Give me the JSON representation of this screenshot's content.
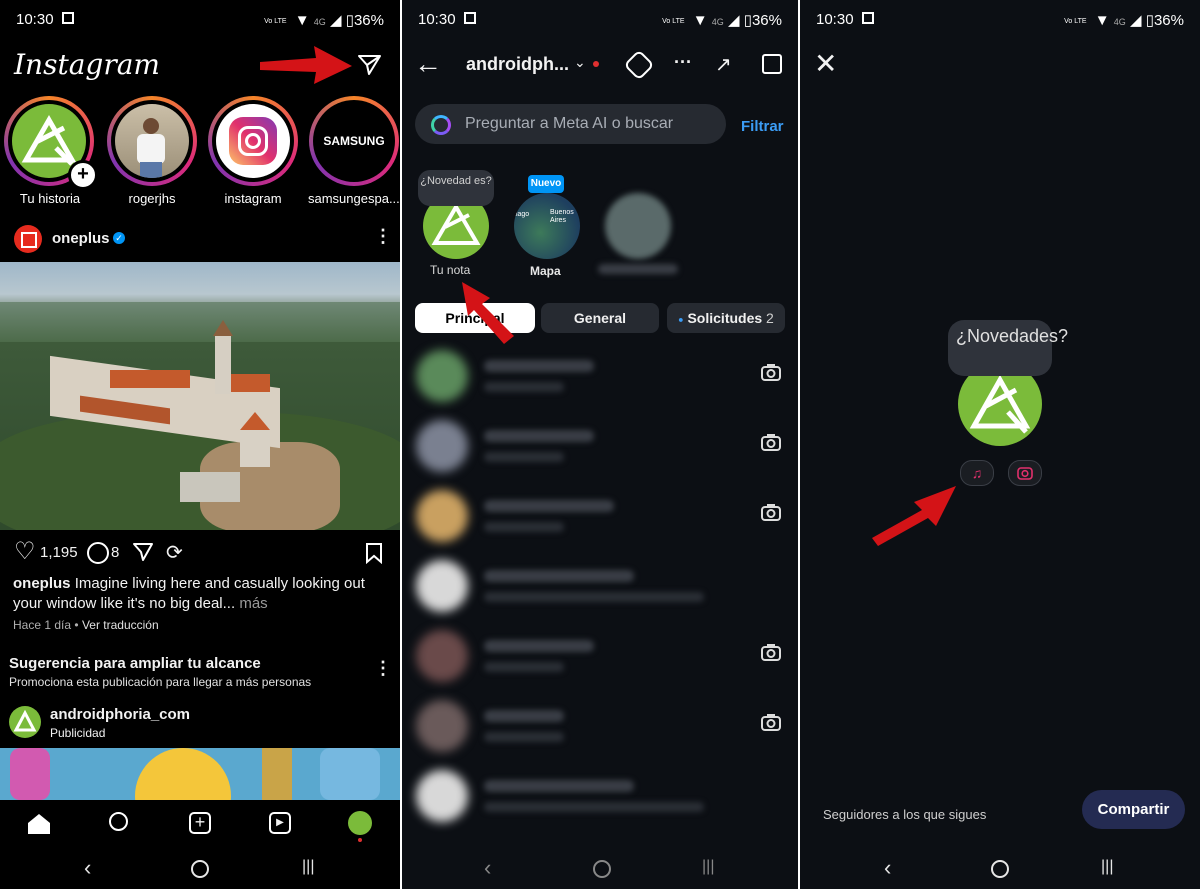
{
  "status": {
    "time": "10:30",
    "net_tag": "Vo\nLTE",
    "network": "4G",
    "battery": "36%"
  },
  "feed": {
    "logo": "Instagram",
    "stories": [
      {
        "label": "Tu historia"
      },
      {
        "label": "rogerjhs"
      },
      {
        "label": "instagram"
      },
      {
        "label": "samsungespa..."
      }
    ],
    "samsung_logo": "SAMSUNG",
    "post": {
      "username": "oneplus",
      "likes": "1,195",
      "comments": "8",
      "caption_user": "oneplus",
      "caption_text": "Imagine living here and casually looking out your window like it's no big deal...",
      "caption_more": "más",
      "time": "Hace 1 día",
      "translate": "Ver traducción"
    },
    "suggestion": {
      "title": "Sugerencia para ampliar tu alcance",
      "subtitle": "Promociona esta publicación para llegar a más personas"
    },
    "ad": {
      "username": "androidphoria_com",
      "label": "Publicidad"
    }
  },
  "inbox": {
    "account": "androidph...",
    "search_placeholder": "Preguntar a Meta AI o buscar",
    "filter": "Filtrar",
    "note_bubble": "¿Novedad es?",
    "note_label": "Tu nota",
    "map_badge": "Nuevo",
    "map_label": "Mapa",
    "map_city1": "tiago",
    "map_city2": "Buenos Aires",
    "tabs": {
      "primary": "Principal",
      "general": "General",
      "requests": "Solicitudes",
      "requests_count": "2"
    }
  },
  "note": {
    "bubble": "¿Novedades?",
    "audience": "Seguidores a los que sigues",
    "share": "Compartir"
  },
  "colors": {
    "accent": "#0095f6",
    "ap_green": "#7bbb3a",
    "arrow_red": "#d41317",
    "share_bg": "#242b52"
  }
}
